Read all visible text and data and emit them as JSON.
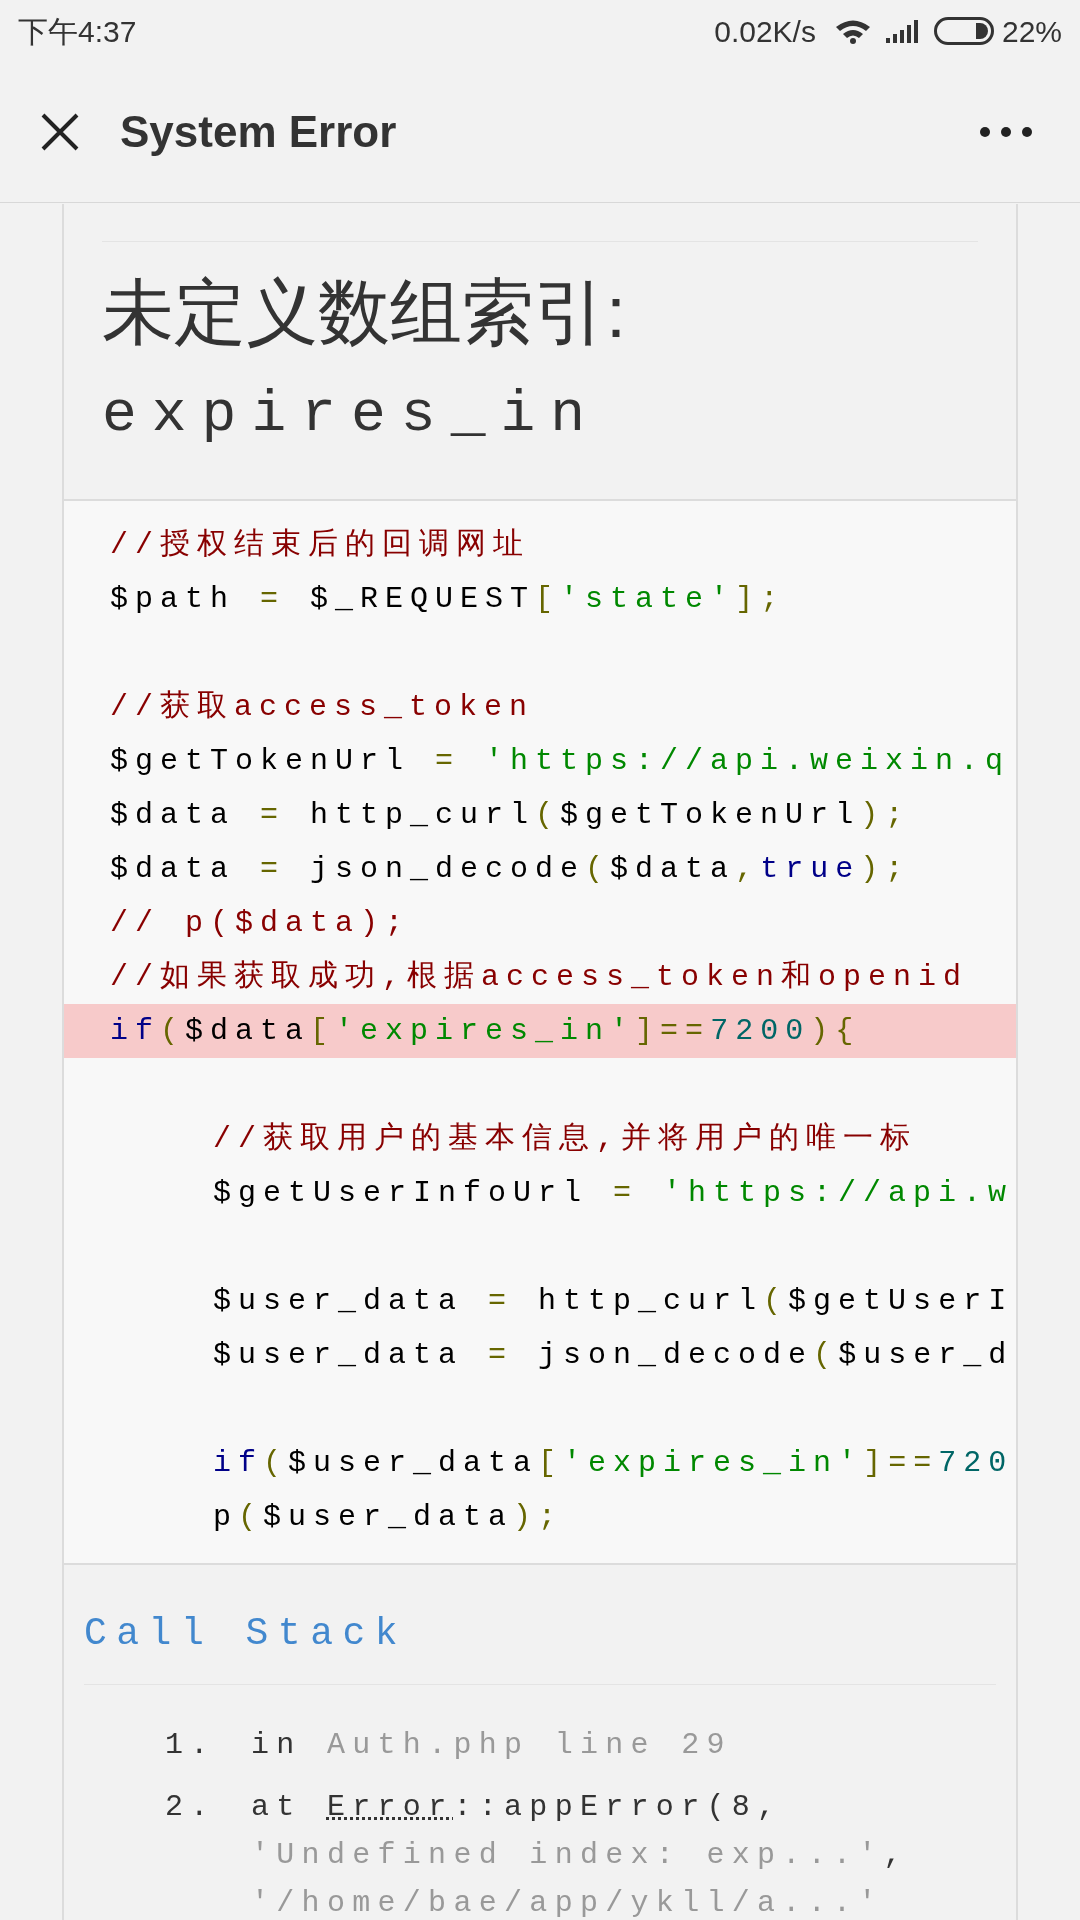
{
  "status_bar": {
    "time": "下午4:37",
    "speed": "0.02K/s",
    "battery": "22%"
  },
  "header": {
    "title": "System Error"
  },
  "error": {
    "message": "未定义数组索引:",
    "index": "expires_in"
  },
  "source": {
    "lines": [
      {
        "kind": "code",
        "indented": false,
        "highlighted": false,
        "tokens": [
          {
            "kind": "comment",
            "text": "//授权结束后的回调网址"
          }
        ]
      },
      {
        "kind": "code",
        "indented": false,
        "highlighted": false,
        "tokens": [
          {
            "kind": "plain",
            "text": "$path "
          },
          {
            "kind": "punct",
            "text": "="
          },
          {
            "kind": "plain",
            "text": " $_REQUEST"
          },
          {
            "kind": "punct",
            "text": "["
          },
          {
            "kind": "string",
            "text": "'state'"
          },
          {
            "kind": "punct",
            "text": "];"
          }
        ]
      },
      {
        "kind": "blank"
      },
      {
        "kind": "code",
        "indented": false,
        "highlighted": false,
        "tokens": [
          {
            "kind": "comment",
            "text": "//获取access_token"
          }
        ]
      },
      {
        "kind": "code",
        "indented": false,
        "highlighted": false,
        "tokens": [
          {
            "kind": "plain",
            "text": "$getTokenUrl "
          },
          {
            "kind": "punct",
            "text": "="
          },
          {
            "kind": "string",
            "text": " 'https://api.weixin.q"
          }
        ]
      },
      {
        "kind": "code",
        "indented": false,
        "highlighted": false,
        "tokens": [
          {
            "kind": "plain",
            "text": "$data "
          },
          {
            "kind": "punct",
            "text": "="
          },
          {
            "kind": "plain",
            "text": " http_curl"
          },
          {
            "kind": "punct",
            "text": "("
          },
          {
            "kind": "plain",
            "text": "$getTokenUrl"
          },
          {
            "kind": "punct",
            "text": ");"
          }
        ]
      },
      {
        "kind": "code",
        "indented": false,
        "highlighted": false,
        "tokens": [
          {
            "kind": "plain",
            "text": "$data "
          },
          {
            "kind": "punct",
            "text": "="
          },
          {
            "kind": "plain",
            "text": " json_decode"
          },
          {
            "kind": "punct",
            "text": "("
          },
          {
            "kind": "plain",
            "text": "$data"
          },
          {
            "kind": "punct",
            "text": ","
          },
          {
            "kind": "keyword",
            "text": "true"
          },
          {
            "kind": "punct",
            "text": ");"
          }
        ]
      },
      {
        "kind": "code",
        "indented": false,
        "highlighted": false,
        "tokens": [
          {
            "kind": "comment",
            "text": "// p($data);"
          }
        ]
      },
      {
        "kind": "code",
        "indented": false,
        "highlighted": false,
        "tokens": [
          {
            "kind": "comment",
            "text": "//如果获取成功,根据access_token和openid"
          }
        ]
      },
      {
        "kind": "code",
        "indented": false,
        "highlighted": true,
        "tokens": [
          {
            "kind": "keyword",
            "text": "if"
          },
          {
            "kind": "punct",
            "text": "("
          },
          {
            "kind": "plain",
            "text": "$data"
          },
          {
            "kind": "punct",
            "text": "["
          },
          {
            "kind": "string",
            "text": "'expires_in'"
          },
          {
            "kind": "punct",
            "text": "]=="
          },
          {
            "kind": "number",
            "text": "7200"
          },
          {
            "kind": "punct",
            "text": "){"
          }
        ]
      },
      {
        "kind": "blank"
      },
      {
        "kind": "code",
        "indented": true,
        "highlighted": false,
        "tokens": [
          {
            "kind": "comment",
            "text": "//获取用户的基本信息,并将用户的唯一标"
          }
        ]
      },
      {
        "kind": "code",
        "indented": true,
        "highlighted": false,
        "tokens": [
          {
            "kind": "plain",
            "text": "$getUserInfoUrl "
          },
          {
            "kind": "punct",
            "text": "="
          },
          {
            "kind": "string",
            "text": " 'https://api.w"
          }
        ]
      },
      {
        "kind": "blank"
      },
      {
        "kind": "code",
        "indented": true,
        "highlighted": false,
        "tokens": [
          {
            "kind": "plain",
            "text": "$user_data "
          },
          {
            "kind": "punct",
            "text": "="
          },
          {
            "kind": "plain",
            "text": " http_curl"
          },
          {
            "kind": "punct",
            "text": "("
          },
          {
            "kind": "plain",
            "text": "$getUserI"
          }
        ]
      },
      {
        "kind": "code",
        "indented": true,
        "highlighted": false,
        "tokens": [
          {
            "kind": "plain",
            "text": "$user_data "
          },
          {
            "kind": "punct",
            "text": "="
          },
          {
            "kind": "plain",
            "text": " json_decode"
          },
          {
            "kind": "punct",
            "text": "("
          },
          {
            "kind": "plain",
            "text": "$user_d"
          }
        ]
      },
      {
        "kind": "blank"
      },
      {
        "kind": "code",
        "indented": true,
        "highlighted": false,
        "tokens": [
          {
            "kind": "keyword",
            "text": "if"
          },
          {
            "kind": "punct",
            "text": "("
          },
          {
            "kind": "plain",
            "text": "$user_data"
          },
          {
            "kind": "punct",
            "text": "["
          },
          {
            "kind": "string",
            "text": "'expires_in'"
          },
          {
            "kind": "punct",
            "text": "]=="
          },
          {
            "kind": "number",
            "text": "720"
          }
        ]
      },
      {
        "kind": "code",
        "indented": true,
        "highlighted": false,
        "tokens": [
          {
            "kind": "plain",
            "text": "p"
          },
          {
            "kind": "punct",
            "text": "("
          },
          {
            "kind": "plain",
            "text": "$user_data"
          },
          {
            "kind": "punct",
            "text": ");"
          }
        ]
      }
    ]
  },
  "call_stack": {
    "title": "Call Stack",
    "items": [
      {
        "number": "1.",
        "parts": [
          {
            "kind": "plain",
            "text": "in "
          },
          {
            "kind": "muted",
            "text": "Auth.php line 29"
          }
        ]
      },
      {
        "number": "2.",
        "parts": [
          {
            "kind": "plain",
            "text": "at "
          },
          {
            "kind": "abbr",
            "text": "Error"
          },
          {
            "kind": "plain",
            "text": "::appError(8, "
          },
          {
            "kind": "muted",
            "text": "'Undefined index: exp...'"
          },
          {
            "kind": "plain",
            "text": ", "
          },
          {
            "kind": "muted",
            "text": "'/home/bae/app/ykll/a...'"
          }
        ]
      }
    ]
  }
}
